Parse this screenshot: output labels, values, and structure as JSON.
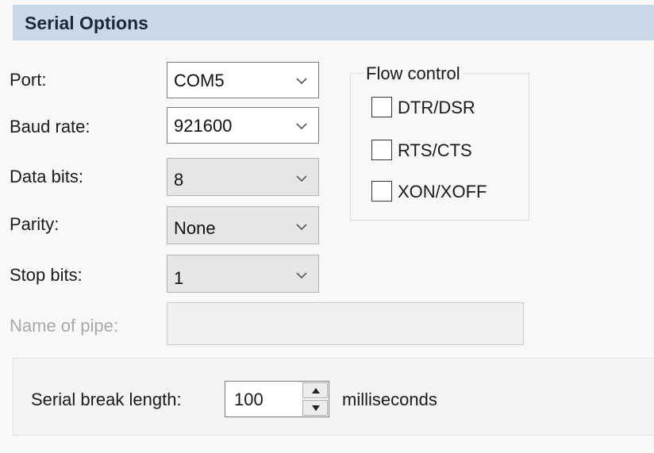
{
  "header": {
    "title": "Serial Options"
  },
  "fields": {
    "port": {
      "label": "Port:",
      "value": "COM5"
    },
    "baud_rate": {
      "label": "Baud rate:",
      "value": "921600"
    },
    "data_bits": {
      "label": "Data bits:",
      "value": "8"
    },
    "parity": {
      "label": "Parity:",
      "value": "None"
    },
    "stop_bits": {
      "label": "Stop bits:",
      "value": "1"
    },
    "pipe_name": {
      "label": "Name of pipe:",
      "value": ""
    }
  },
  "flow_control": {
    "legend": "Flow control",
    "options": [
      {
        "label": "DTR/DSR",
        "checked": false
      },
      {
        "label": "RTS/CTS",
        "checked": false
      },
      {
        "label": "XON/XOFF",
        "checked": false
      }
    ]
  },
  "serial_break": {
    "label": "Serial break length:",
    "value": "100",
    "unit": "milliseconds"
  },
  "icons": {
    "dropdown": "chevron-down-icon",
    "spin_up": "triangle-up-icon",
    "spin_down": "triangle-down-icon"
  },
  "colors": {
    "header_bg": "#cad9e8",
    "disabled_text": "#a8a8a8",
    "readonly_bg": "#e6e6e6"
  }
}
